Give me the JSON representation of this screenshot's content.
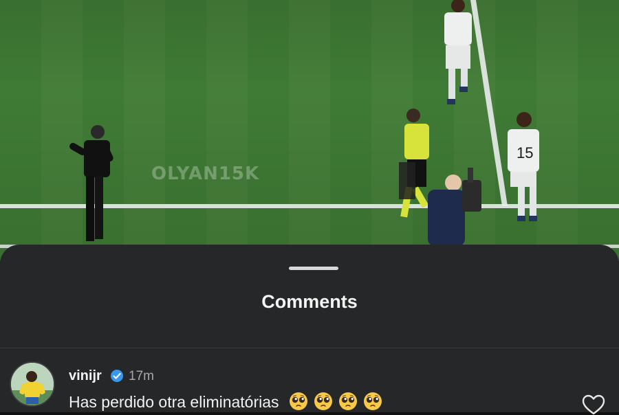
{
  "video": {
    "watermark": "OLYAN15K",
    "player_number": "15"
  },
  "comments_sheet": {
    "title": "Comments",
    "comment": {
      "username": "vinijr",
      "verified_icon": "verified-badge-icon",
      "time": "17m",
      "text": "Has perdido otra eliminatórias",
      "emoji_name": "pleading-face-emoji",
      "emoji_count": 4,
      "like_icon": "heart-outline-icon"
    }
  },
  "colors": {
    "sheet_bg": "#252728",
    "verified_blue": "#3897f0",
    "pitch_green": "#427a37",
    "referee_yellow": "#d7e23a"
  }
}
